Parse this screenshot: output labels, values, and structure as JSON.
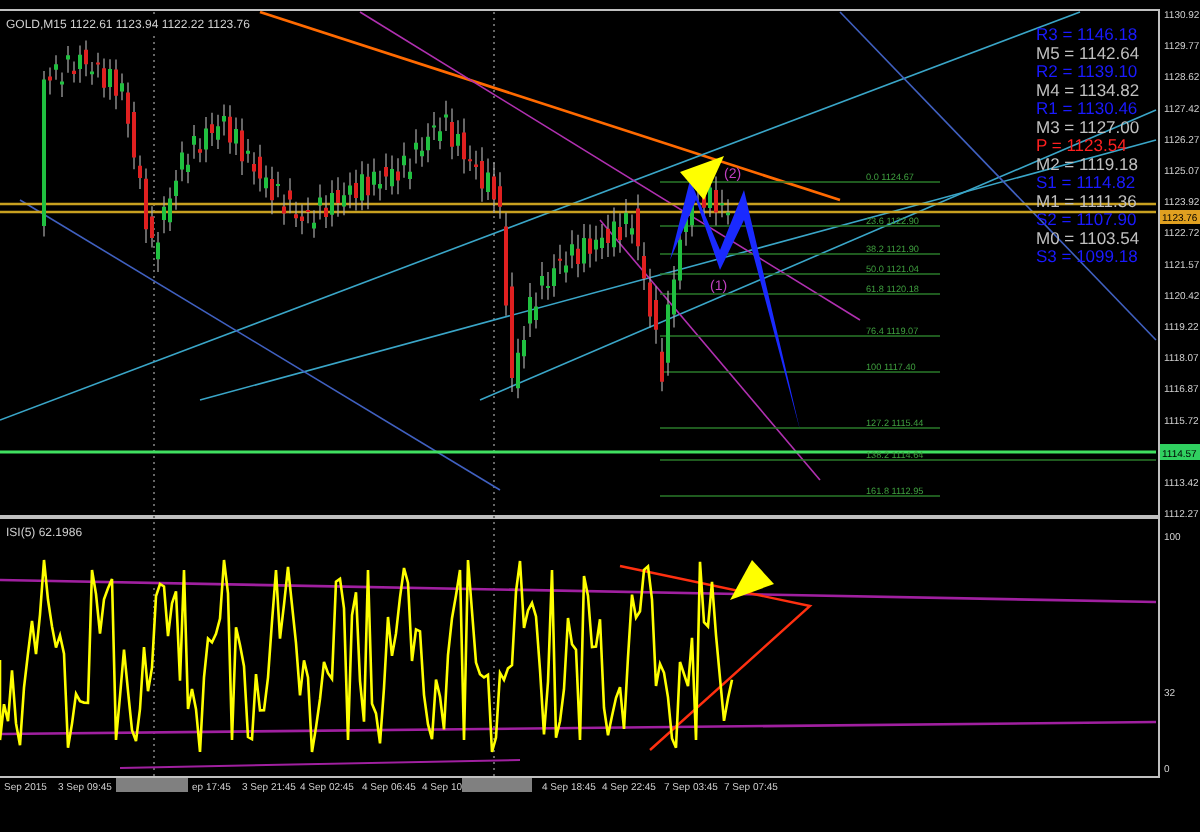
{
  "chart": {
    "header": "GOLD,M15  1122.61 1123.94 1122.22 1123.76",
    "price_axis": [
      "1130.92",
      "1129.77",
      "1128.62",
      "1127.42",
      "1126.27",
      "1125.07",
      "1123.92",
      "1122.72",
      "1121.57",
      "1120.42",
      "1119.22",
      "1118.07",
      "1116.87",
      "1115.72",
      "1113.42",
      "1112.27"
    ],
    "current_price": "1123.76",
    "line_price": "1114.57",
    "pivot_levels": [
      {
        "label": "R3 = 1146.18",
        "color": "#1a1aff"
      },
      {
        "label": "M5 = 1142.64",
        "color": "#c0c0c0"
      },
      {
        "label": "R2 = 1139.10",
        "color": "#1a1aff"
      },
      {
        "label": "M4 = 1134.82",
        "color": "#c0c0c0"
      },
      {
        "label": "R1 = 1130.46",
        "color": "#1a1aff"
      },
      {
        "label": "M3 = 1127.00",
        "color": "#c0c0c0"
      },
      {
        "label": "P = 1123.54",
        "color": "#ff2020"
      },
      {
        "label": "M2 = 1119.18",
        "color": "#c0c0c0"
      },
      {
        "label": "S1 = 1114.82",
        "color": "#1a1aff"
      },
      {
        "label": "M1 = 1111.36",
        "color": "#c0c0c0"
      },
      {
        "label": "S2 = 1107.90",
        "color": "#1a1aff"
      },
      {
        "label": "M0 = 1103.54",
        "color": "#c0c0c0"
      },
      {
        "label": "S3 = 1099.18",
        "color": "#1a1aff"
      }
    ],
    "fib_labels": [
      "0.0 1124.67",
      "23.6 1122.90",
      "38.2 1121.90",
      "50.0 1121.04",
      "61.8 1120.18",
      "76.4 1119.07",
      "100 1117.40",
      "127.2 1115.44",
      "138.2 1114.64",
      "161.8 1112.95"
    ],
    "wave_labels": [
      "(2)",
      "(1)"
    ]
  },
  "indicator": {
    "title": "ISI(5) 62.1986",
    "axis": [
      "100",
      "32",
      "0"
    ]
  },
  "time_axis": [
    "Sep 2015",
    "3 Sep 09:45",
    "ep 17:45",
    "3 Sep 21:45",
    "4 Sep 02:45",
    "4 Sep 06:45",
    "4 Sep 10",
    "4 Sep 18:45",
    "4 Sep 22:45",
    "7 Sep 03:45",
    "7 Sep 07:45"
  ]
}
